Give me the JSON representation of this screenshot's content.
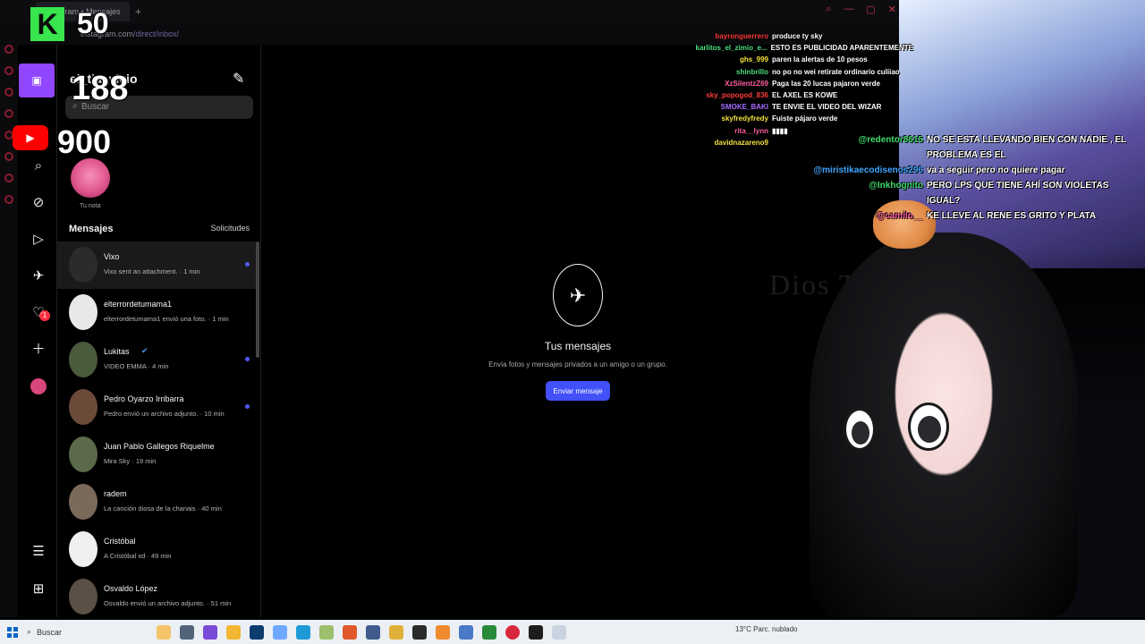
{
  "browser": {
    "tab_title": "Instagram • Mensajes",
    "url_domain": "instagram.com",
    "url_path": "/direct/inbox/"
  },
  "instagram": {
    "account_name": "el_tia_vicio",
    "search_placeholder": "Buscar",
    "note_label": "Tu nota",
    "messages_heading": "Mensajes",
    "requests_link": "Solicitudes",
    "notification_count": "1",
    "conversations": [
      {
        "name": "Vixo",
        "preview": "Vixo sent an attachment. · 1 min",
        "unread": true,
        "verified": false
      },
      {
        "name": "elterrordetumama1",
        "preview": "elterrordetumama1 envió una foto. · 1 min",
        "unread": false,
        "verified": false
      },
      {
        "name": "Lukitas",
        "preview": "VIDEO EMMA · 4 min",
        "unread": true,
        "verified": true
      },
      {
        "name": "Pedro Oyarzo Irribarra",
        "preview": "Pedro envió un archivo adjunto. · 10 min",
        "unread": true,
        "verified": false
      },
      {
        "name": "Juan Pablo Gallegos Riquelme",
        "preview": "Mira Sky · 19 min",
        "unread": false,
        "verified": false
      },
      {
        "name": "radem",
        "preview": "La canción diosa de la chanais · 40 min",
        "unread": false,
        "verified": false
      },
      {
        "name": "Cristóbal",
        "preview": "A Cristóbal xd · 49 min",
        "unread": false,
        "verified": false
      },
      {
        "name": "Osvaldo López",
        "preview": "Osvaldo envió un archivo adjunto. · 51 min",
        "unread": false,
        "verified": false
      }
    ],
    "empty_title": "Tus mensajes",
    "empty_subtitle": "Envía fotos y mensajes privados a un amigo o un grupo.",
    "send_button": "Enviar mensaje"
  },
  "stream_overlay": {
    "kick_count": "50",
    "twitch_count": "188",
    "youtube_count": "900",
    "overlay_phrase": "Dios Te Ama",
    "chat_small": [
      {
        "user": "bayronguerrero",
        "text": "produce ty sky",
        "color": "#ff3b3b"
      },
      {
        "user": "karlitos_el_zimio_e...",
        "text": "ESTO ES PUBLICIDAD APARENTEMENTE",
        "color": "#4ade80"
      },
      {
        "user": "ghs_999",
        "text": "paren la alertas de 10 pesos",
        "color": "#f2e13c"
      },
      {
        "user": "shinbrillo",
        "text": "no po no wei retirate ordinario culiiao",
        "color": "#4ade80"
      },
      {
        "user": "XzSilentzZ69",
        "text": "Paga las 20 lucas pajaron verde",
        "color": "#ff5da2"
      },
      {
        "user": "sky_popogod_836",
        "text": "EL AXEL ES KOWE",
        "color": "#ff3b3b"
      },
      {
        "user": "SMOKE_BAKI",
        "text": "TE ENVIE EL VIDEO DEL WIZAR",
        "color": "#a46bff"
      },
      {
        "user": "skyfredyfredy",
        "text": "Fuiste pájaro verde",
        "color": "#f2e13c"
      },
      {
        "user": "rita__lynn",
        "text": "▮▮▮▮",
        "color": "#ff5da2"
      },
      {
        "user": "davidnazareno9",
        "text": "",
        "color": "#f2e13c"
      }
    ],
    "chat_big": [
      {
        "user": "@redentor8615",
        "text": "NO SE ESTA LLEVANDO BIEN CON NADIE , EL PROBLEMA ES EL",
        "color": "#3fdc6c"
      },
      {
        "user": "@miristikaecodisenos296",
        "text": "va a seguir pero no quiere pagar",
        "color": "#3fa6ff"
      },
      {
        "user": "@Inkhognito",
        "text": "PERO LPS QUE TIENE AHÍ SON VIOLETAS IGUAL?",
        "color": "#3fdc6c"
      },
      {
        "user": "@camilo__",
        "text": "KE LLEVE AL RENE ES GRITO Y PLATA",
        "color": "#ff5da2"
      }
    ]
  },
  "taskbar": {
    "search_label": "Buscar",
    "weather": "13°C  Parc. nublado"
  }
}
